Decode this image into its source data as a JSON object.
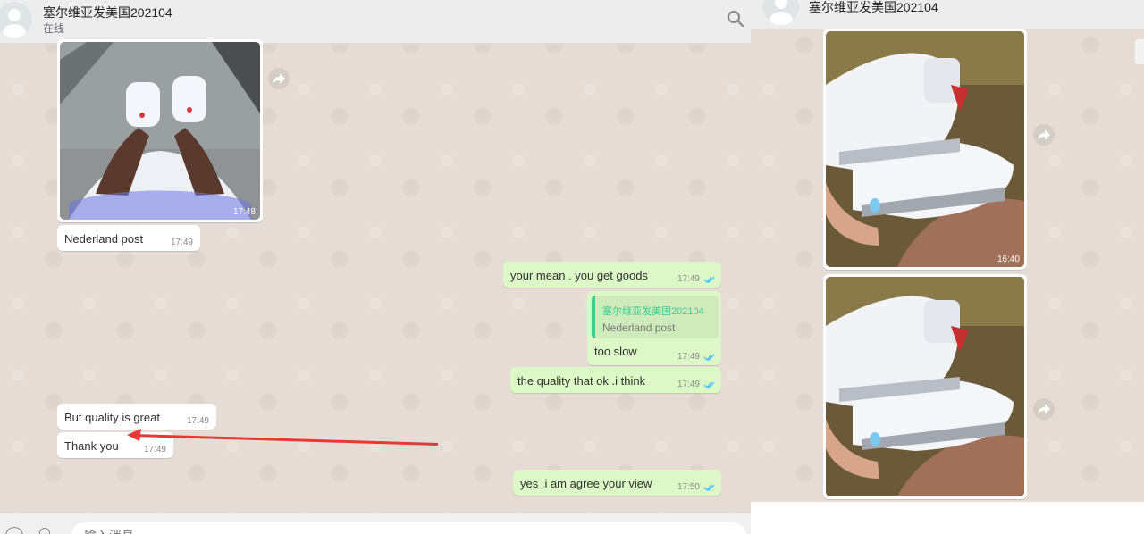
{
  "chat": {
    "contact_name": "塞尔维亚发美国202104",
    "status": "在线",
    "messages": [
      {
        "type": "image",
        "dir": "in",
        "time": "17:48"
      },
      {
        "type": "text",
        "dir": "in",
        "text": "Nederland post",
        "time": "17:49"
      },
      {
        "type": "text",
        "dir": "out",
        "text": "your mean . you get goods",
        "time": "17:49"
      },
      {
        "type": "reply",
        "dir": "out",
        "quote_name": "塞尔维亚发美国202104",
        "quote_text": "Nederland post",
        "text": "too slow",
        "time": "17:49"
      },
      {
        "type": "text",
        "dir": "out",
        "text": "the quality that ok .i think",
        "time": "17:49"
      },
      {
        "type": "text",
        "dir": "in",
        "text": "But quality is great",
        "time": "17:49"
      },
      {
        "type": "text",
        "dir": "in",
        "text": "Thank you",
        "time": "17:49"
      },
      {
        "type": "text",
        "dir": "out",
        "text": "yes .i am agree your view",
        "time": "17:50"
      }
    ],
    "composer_placeholder": "输入消息"
  },
  "right_panel": {
    "contact_name": "塞尔维亚发美国202104",
    "images": [
      {
        "time": "16:40"
      },
      {
        "time": ""
      }
    ]
  },
  "annotation": {
    "type": "red-arrow",
    "color": "#e53935"
  },
  "colors": {
    "chat_bg": "#e5ddd5",
    "incoming_bubble": "#ffffff",
    "outgoing_bubble": "#dcf8c6",
    "quote_accent": "#35cd96",
    "read_ticks": "#4fc3f7"
  },
  "icons": [
    "search-icon",
    "forward-icon",
    "double-check-icon",
    "emoji-icon",
    "attach-icon",
    "avatar-icon"
  ]
}
